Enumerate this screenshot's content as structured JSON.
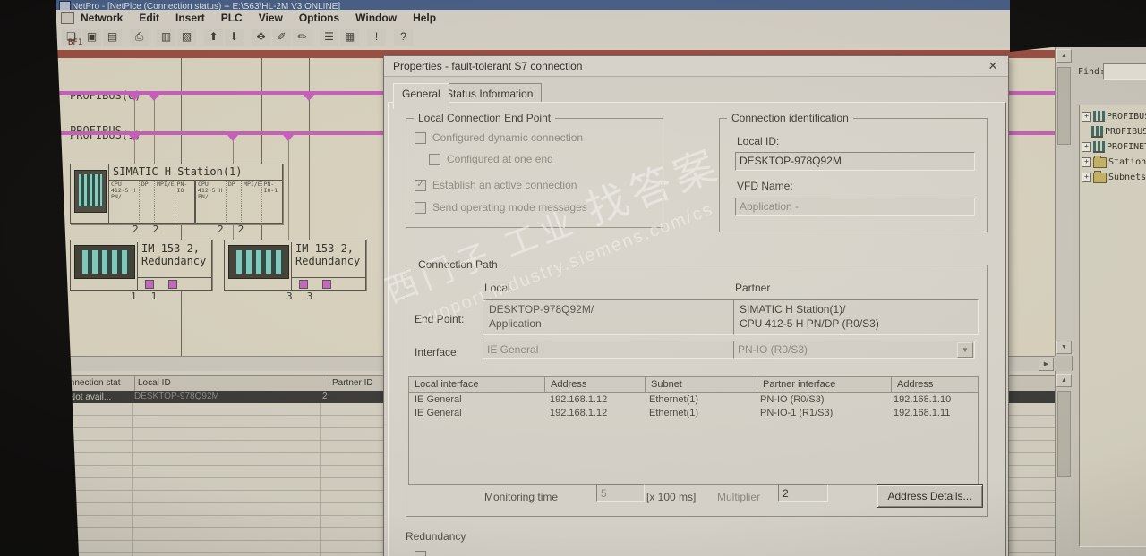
{
  "window": {
    "title": "NetPro - [NetPlce (Connection status) -- E:\\S63\\HL-2M V3  ONLINE]"
  },
  "menu": {
    "items": [
      "Network",
      "Edit",
      "Insert",
      "PLC",
      "View",
      "Options",
      "Window",
      "Help"
    ]
  },
  "toolbar": {
    "buttons": [
      {
        "name": "open",
        "glyph": "❏"
      },
      {
        "name": "save",
        "glyph": "▣"
      },
      {
        "name": "save-options",
        "glyph": "▤"
      },
      {
        "name": "print",
        "glyph": "⎙"
      },
      {
        "name": "copy",
        "glyph": "▥"
      },
      {
        "name": "paste",
        "glyph": "▧"
      },
      {
        "name": "upload-station",
        "glyph": "⬆"
      },
      {
        "name": "download-station",
        "glyph": "⬇"
      },
      {
        "name": "rearrange",
        "glyph": "✥"
      },
      {
        "name": "link",
        "glyph": "✐"
      },
      {
        "name": "break-link",
        "glyph": "✏"
      },
      {
        "name": "catalog",
        "glyph": "☰"
      },
      {
        "name": "address-overview",
        "glyph": "▦"
      },
      {
        "name": "fault",
        "glyph": "!"
      },
      {
        "name": "help",
        "glyph": "?"
      }
    ]
  },
  "canvas": {
    "top_label": "BF1",
    "bus0": {
      "name": "PROFIBUS(0)",
      "type": "PROFIBUS"
    },
    "bus1": {
      "name": "PROFIBUS(1)",
      "type": "PROFIBUS"
    },
    "station": {
      "title": "SIMATIC H Station(1)",
      "rack_left": {
        "cols": [
          "CPU 412-5 H PN/",
          "DP",
          "MPI/E",
          "PN-IO"
        ]
      },
      "rack_right": {
        "cols": [
          "CPU 412-5 H PN/",
          "DP",
          "MPI/E",
          "PN-IO-1"
        ]
      },
      "numbers": [
        "2",
        "2",
        "2",
        "2"
      ]
    },
    "im1": {
      "line1": "IM 153-2,",
      "line2": "Redundancy",
      "numbers": [
        "1",
        "1"
      ]
    },
    "im2": {
      "line1": "IM 153-2,",
      "line2": "Redundancy",
      "numbers": [
        "3",
        "3"
      ]
    }
  },
  "bottom_table": {
    "headers": [
      "Connection stat",
      "Local ID",
      "Partner ID"
    ],
    "row": {
      "status": "Not avail...",
      "local_id": "DESKTOP-978Q92M",
      "partner_id": "2"
    }
  },
  "right_panel": {
    "find_label": "Find:",
    "tree": [
      {
        "label": "PROFIBUS",
        "icon": "network",
        "expand": "+"
      },
      {
        "label": "PROFIBUS-",
        "icon": "network",
        "expand": ""
      },
      {
        "label": "PROFINET",
        "icon": "network",
        "expand": "+"
      },
      {
        "label": "Stations",
        "icon": "folder",
        "expand": "+"
      },
      {
        "label": "Subnets",
        "icon": "folder",
        "expand": "+"
      }
    ]
  },
  "dialog": {
    "title": "Properties - fault-tolerant  S7 connection",
    "close": "✕",
    "tabs": [
      {
        "label": "General"
      },
      {
        "label": "Status Information"
      }
    ],
    "local_end_point": {
      "legend": "Local Connection End Point",
      "cb1": {
        "label": "Configured dynamic connection",
        "mark": ""
      },
      "cb2": {
        "label": "Configured at one end",
        "mark": ""
      },
      "cb3": {
        "label": "Establish an active connection",
        "mark": "✓"
      },
      "cb4": {
        "label": "Send operating mode messages",
        "mark": ""
      }
    },
    "conn_id": {
      "legend": "Connection identification",
      "local_id_label": "Local ID:",
      "local_id_value": "DESKTOP-978Q92M",
      "vfd_label": "VFD Name:",
      "vfd_value": "Application -"
    },
    "conn_path": {
      "legend": "Connection Path",
      "local_header": "Local",
      "partner_header": "Partner",
      "end_point_label": "End Point:",
      "local_end_point": "DESKTOP-978Q92M/\nApplication",
      "partner_end_point": "SIMATIC H Station(1)/\nCPU 412-5 H PN/DP (R0/S3)",
      "interface_label": "Interface:",
      "local_interface": "IE General",
      "partner_interface": "PN-IO (R0/S3)",
      "combo_arrow": "▼",
      "table": {
        "headers": [
          "Local interface",
          "Address",
          "Subnet",
          "Partner interface",
          "Address"
        ],
        "rows": [
          [
            "IE General",
            "192.168.1.12",
            "Ethernet(1)",
            "PN-IO (R0/S3)",
            "192.168.1.10"
          ],
          [
            "IE General",
            "192.168.1.12",
            "Ethernet(1)",
            "PN-IO-1 (R1/S3)",
            "192.168.1.11"
          ]
        ]
      },
      "monitoring_label": "Monitoring time",
      "monitoring_value": "5",
      "unit_label": "[x 100 ms]",
      "multiplier_label": "Multiplier",
      "multiplier_value": "2",
      "address_details_label": "Address Details..."
    },
    "redundancy_label": "Redundancy"
  },
  "watermarks": {
    "line1a": "西门子 工业",
    "line1b": "找答案",
    "line2": "support.industry.siemens.com/cs"
  },
  "colors": {
    "bus_magenta": "#cc5fc2",
    "ethernet_red": "#9c4f44",
    "status_red": "#b03232",
    "selection_dark": "#3a3a38",
    "folder_yellow": "#c9b768",
    "titlebar_blue": "#47608a"
  }
}
